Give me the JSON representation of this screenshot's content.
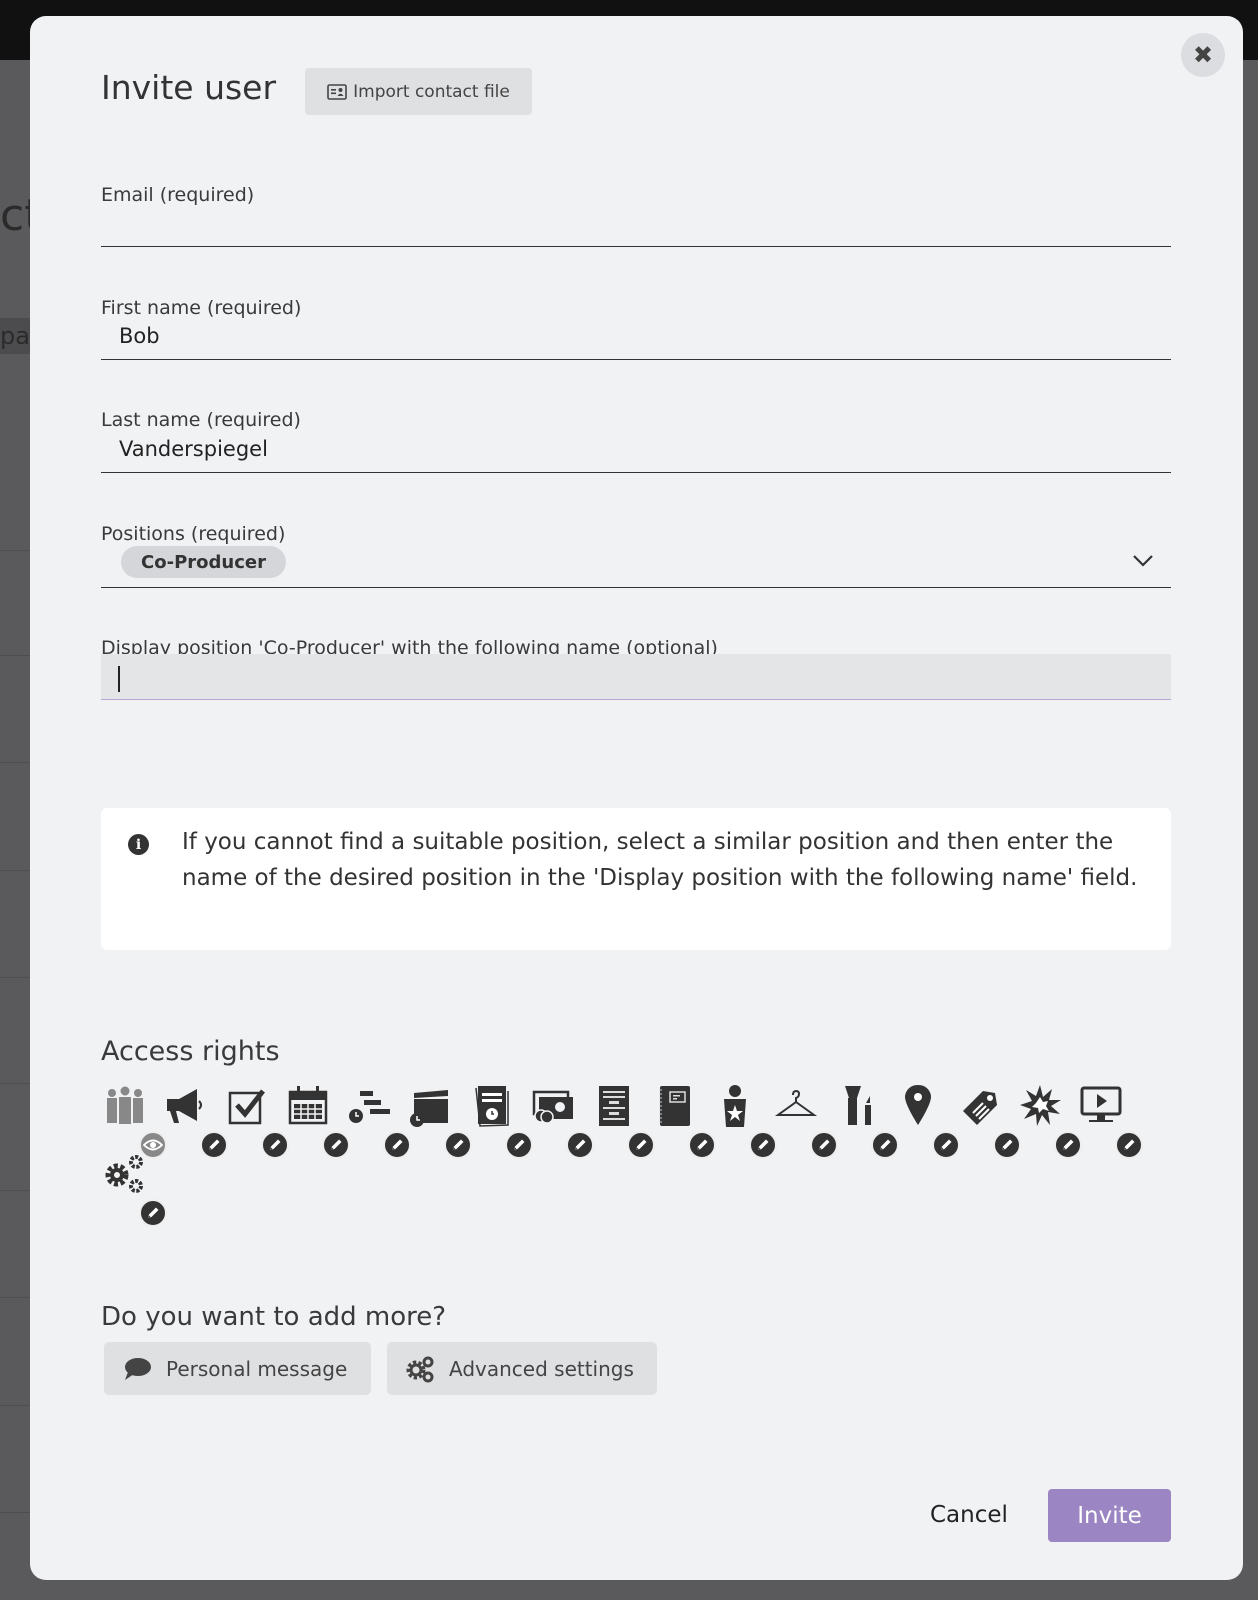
{
  "background": {
    "partial_text": "ct",
    "partial_text2": "pa"
  },
  "dialog": {
    "title": "Invite user",
    "import_button": "Import contact file",
    "close_icon": "close-icon"
  },
  "form": {
    "email": {
      "label": "Email (required)",
      "value": ""
    },
    "first_name": {
      "label": "First name (required)",
      "value": "Bob"
    },
    "last_name": {
      "label": "Last name (required)",
      "value": "Vanderspiegel"
    },
    "positions": {
      "label": "Positions (required)",
      "selected": [
        "Co-Producer"
      ]
    },
    "display_position": {
      "label": "Display position 'Co-Producer' with the following name (optional)",
      "value": ""
    }
  },
  "info": {
    "text": "If you cannot find a suitable position, select a similar position and then enter the name of the desired position in the 'Display position with the following name' field."
  },
  "access_rights": {
    "heading": "Access rights",
    "items": [
      {
        "icon": "users-icon",
        "mode": "view"
      },
      {
        "icon": "megaphone-icon",
        "mode": "edit"
      },
      {
        "icon": "checkbox-icon",
        "mode": "edit"
      },
      {
        "icon": "calendar-icon",
        "mode": "edit"
      },
      {
        "icon": "schedule-bars-icon",
        "mode": "edit"
      },
      {
        "icon": "clapperboard-icon",
        "mode": "edit"
      },
      {
        "icon": "document-clock-icon",
        "mode": "edit"
      },
      {
        "icon": "money-icon",
        "mode": "edit"
      },
      {
        "icon": "script-icon",
        "mode": "edit"
      },
      {
        "icon": "notebook-icon",
        "mode": "edit"
      },
      {
        "icon": "person-star-icon",
        "mode": "edit"
      },
      {
        "icon": "hanger-icon",
        "mode": "edit"
      },
      {
        "icon": "makeup-icon",
        "mode": "edit"
      },
      {
        "icon": "map-pin-icon",
        "mode": "edit"
      },
      {
        "icon": "tag-icon",
        "mode": "edit"
      },
      {
        "icon": "explosion-icon",
        "mode": "edit"
      },
      {
        "icon": "monitor-play-icon",
        "mode": "edit"
      },
      {
        "icon": "gears-icon",
        "mode": "edit"
      }
    ]
  },
  "more": {
    "heading": "Do you want to add more?",
    "personal_message": "Personal message",
    "advanced_settings": "Advanced settings"
  },
  "footer": {
    "cancel": "Cancel",
    "invite": "Invite"
  },
  "colors": {
    "accent": "#9b85c2",
    "modal_bg": "#f1f2f4",
    "icon": "#333333"
  }
}
